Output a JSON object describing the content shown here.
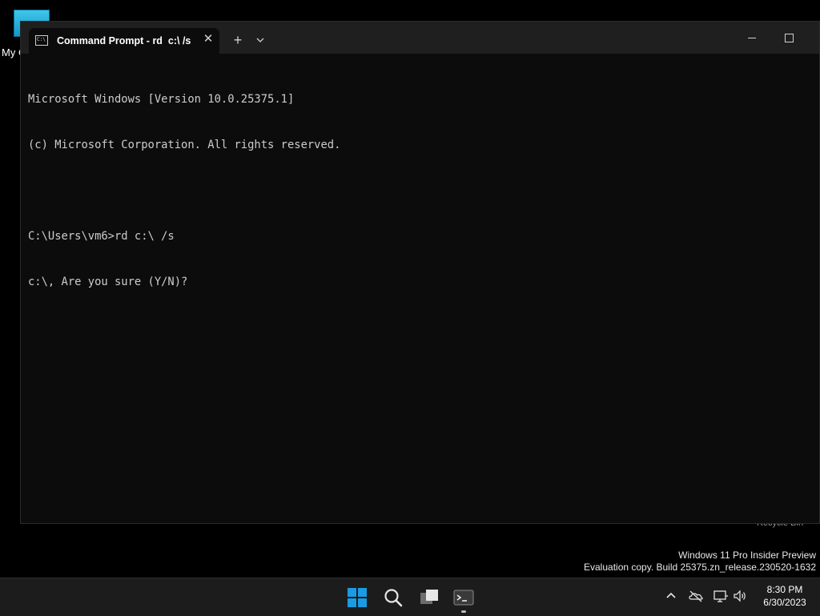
{
  "desktop": {
    "my_pc_label": "My C",
    "recycle_bin_label": "Recycle Bin"
  },
  "terminal": {
    "tab_title": "Command Prompt - rd  c:\\ /s",
    "tab_icon_text": "C:\\",
    "new_tab_symbol": "+",
    "close_symbol": "✕",
    "console_lines": [
      "Microsoft Windows [Version 10.0.25375.1]",
      "(c) Microsoft Corporation. All rights reserved.",
      "",
      "C:\\Users\\vm6>rd c:\\ /s",
      "c:\\, Are you sure (Y/N)?"
    ]
  },
  "watermark": {
    "line1": "Windows 11 Pro Insider Preview",
    "line2": "Evaluation copy. Build 25375.zn_release.230520-1632"
  },
  "taskbar": {
    "time": "8:30 PM",
    "date": "6/30/2023",
    "icons": [
      "start-icon",
      "search-icon",
      "task-view-icon",
      "terminal-icon"
    ],
    "tray_icons": [
      "chevron-up-icon",
      "onedrive-icon",
      "network-icon",
      "volume-icon"
    ],
    "accent_color": "#1a9be3"
  }
}
